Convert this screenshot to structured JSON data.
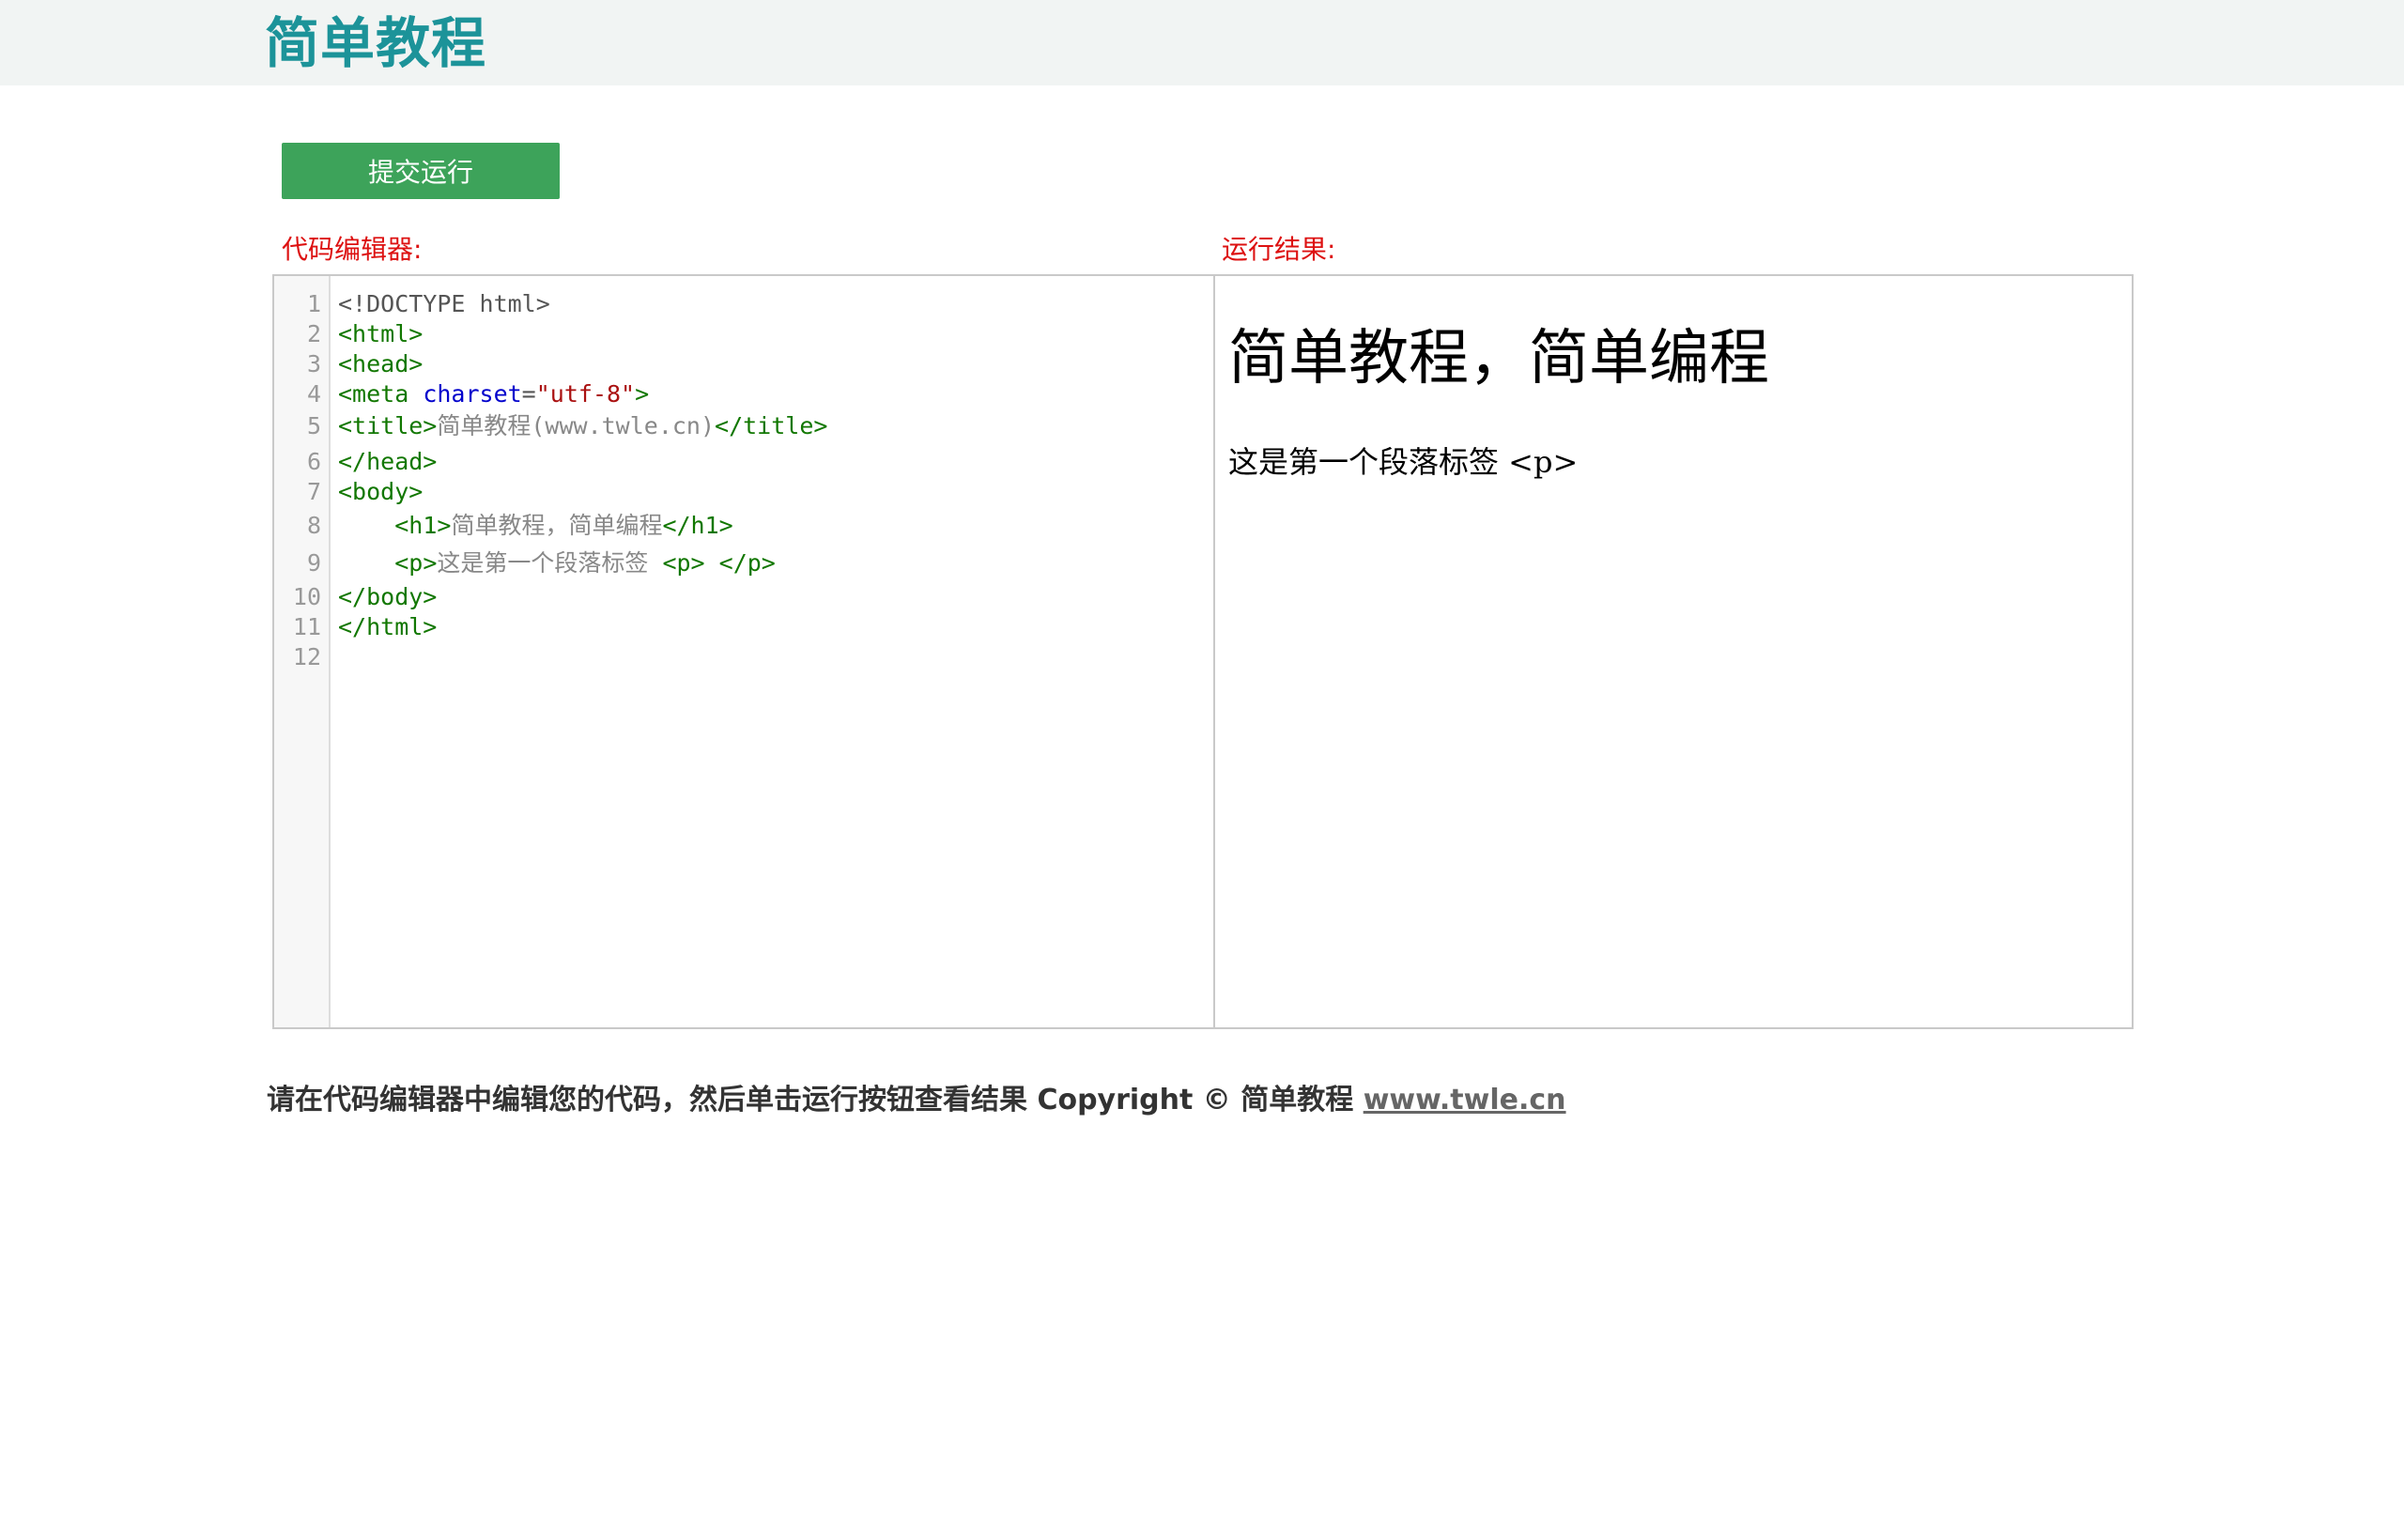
{
  "header": {
    "logo_text": "简单教程"
  },
  "toolbar": {
    "run_label": "提交运行"
  },
  "editor": {
    "label": "代码编辑器:",
    "lines": [
      {
        "n": "1",
        "tokens": [
          {
            "c": "tok-plain",
            "t": "<!DOCTYPE html>"
          }
        ]
      },
      {
        "n": "2",
        "tokens": [
          {
            "c": "tok-tag",
            "t": "<html>"
          }
        ]
      },
      {
        "n": "3",
        "tokens": [
          {
            "c": "tok-tag",
            "t": "<head>"
          }
        ]
      },
      {
        "n": "4",
        "tokens": [
          {
            "c": "tok-tag",
            "t": "<meta "
          },
          {
            "c": "tok-attr",
            "t": "charset"
          },
          {
            "c": "tok-plain",
            "t": "="
          },
          {
            "c": "tok-str",
            "t": "\"utf-8\""
          },
          {
            "c": "tok-tag",
            "t": ">"
          }
        ]
      },
      {
        "n": "5",
        "tokens": [
          {
            "c": "tok-tag",
            "t": "<title>"
          },
          {
            "c": "tok-text",
            "t": "简单教程(www.twle.cn)"
          },
          {
            "c": "tok-tag",
            "t": "</title>"
          }
        ]
      },
      {
        "n": "6",
        "tokens": [
          {
            "c": "tok-tag",
            "t": "</head>"
          }
        ]
      },
      {
        "n": "7",
        "tokens": [
          {
            "c": "tok-tag",
            "t": "<body>"
          }
        ]
      },
      {
        "n": "8",
        "tokens": [
          {
            "c": "tok-plain",
            "t": "    "
          },
          {
            "c": "tok-tag",
            "t": "<h1>"
          },
          {
            "c": "tok-text",
            "t": "简单教程，简单编程"
          },
          {
            "c": "tok-tag",
            "t": "</h1>"
          }
        ]
      },
      {
        "n": "9",
        "tokens": [
          {
            "c": "tok-plain",
            "t": "    "
          },
          {
            "c": "tok-tag",
            "t": "<p>"
          },
          {
            "c": "tok-text",
            "t": "这是第一个段落标签 "
          },
          {
            "c": "tok-tag",
            "t": "<p> </p>"
          }
        ]
      },
      {
        "n": "10",
        "tokens": [
          {
            "c": "tok-tag",
            "t": "</body>"
          }
        ]
      },
      {
        "n": "11",
        "tokens": [
          {
            "c": "tok-tag",
            "t": "</html>"
          }
        ]
      },
      {
        "n": "12",
        "tokens": []
      }
    ]
  },
  "result": {
    "label": "运行结果:",
    "heading": "简单教程，简单编程",
    "paragraph": "这是第一个段落标签 <p>"
  },
  "footer": {
    "text": "请在代码编辑器中编辑您的代码，然后单击运行按钮查看结果 Copyright © 简单教程 ",
    "link_text": "www.twle.cn"
  },
  "colors": {
    "brand": "#1c9399",
    "run_button_bg": "#3da35a",
    "run_button_text": "#ffffff",
    "label_red": "#dd1111"
  }
}
